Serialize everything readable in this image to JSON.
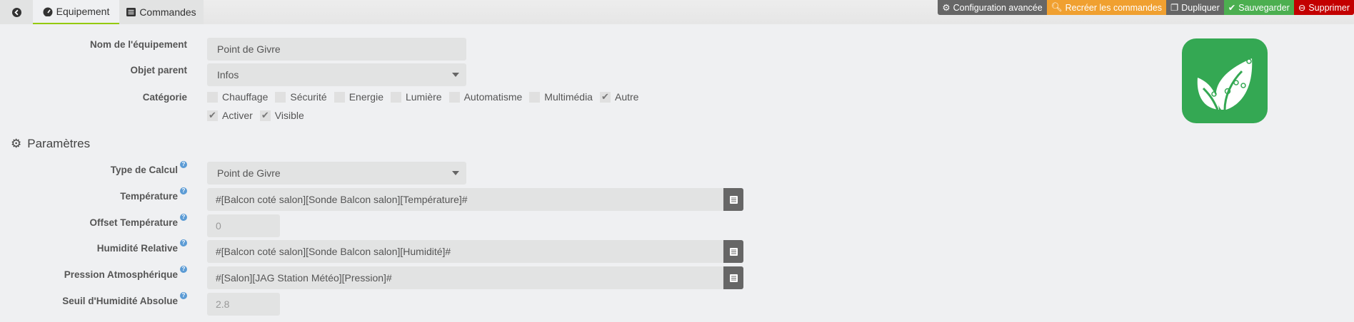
{
  "tabs": {
    "back_icon": "arrow-circle-left-icon",
    "equipement": "Equipement",
    "commandes": "Commandes"
  },
  "toolbar": {
    "config": {
      "label": "Configuration avancée",
      "color": "#666666"
    },
    "recreate": {
      "label": "Recréer les commandes",
      "color": "#f0a030"
    },
    "duplicate": {
      "label": "Dupliquer",
      "color": "#666666"
    },
    "save": {
      "label": "Sauvegarder",
      "color": "#4caf50"
    },
    "delete": {
      "label": "Supprimer",
      "color": "#c30000"
    }
  },
  "form": {
    "name": {
      "label": "Nom de l'équipement",
      "value": "Point de Givre"
    },
    "parent": {
      "label": "Objet parent",
      "value": "Infos"
    },
    "category": {
      "label": "Catégorie",
      "options": [
        {
          "label": "Chauffage",
          "checked": false
        },
        {
          "label": "Sécurité",
          "checked": false
        },
        {
          "label": "Energie",
          "checked": false
        },
        {
          "label": "Lumière",
          "checked": false
        },
        {
          "label": "Automatisme",
          "checked": false
        },
        {
          "label": "Multimédia",
          "checked": false
        },
        {
          "label": "Autre",
          "checked": true
        }
      ]
    },
    "activer": {
      "label": "Activer",
      "checked": true
    },
    "visible": {
      "label": "Visible",
      "checked": true
    }
  },
  "params": {
    "title": "Paramètres",
    "calc_type": {
      "label": "Type de Calcul",
      "value": "Point de Givre"
    },
    "temperature": {
      "label": "Température",
      "value": "#[Balcon coté salon][Sonde Balcon salon][Température]#"
    },
    "offset": {
      "label": "Offset Température",
      "placeholder": "0"
    },
    "humidity": {
      "label": "Humidité Relative",
      "value": "#[Balcon coté salon][Sonde Balcon salon][Humidité]#"
    },
    "pressure": {
      "label": "Pression Atmosphérique",
      "value": "#[Salon][JAG Station Météo][Pression]#"
    },
    "threshold": {
      "label": "Seuil d'Humidité Absolue",
      "placeholder": "2.8"
    }
  },
  "logo": {
    "icon": "leaf-plant-icon",
    "color": "#34a853"
  }
}
